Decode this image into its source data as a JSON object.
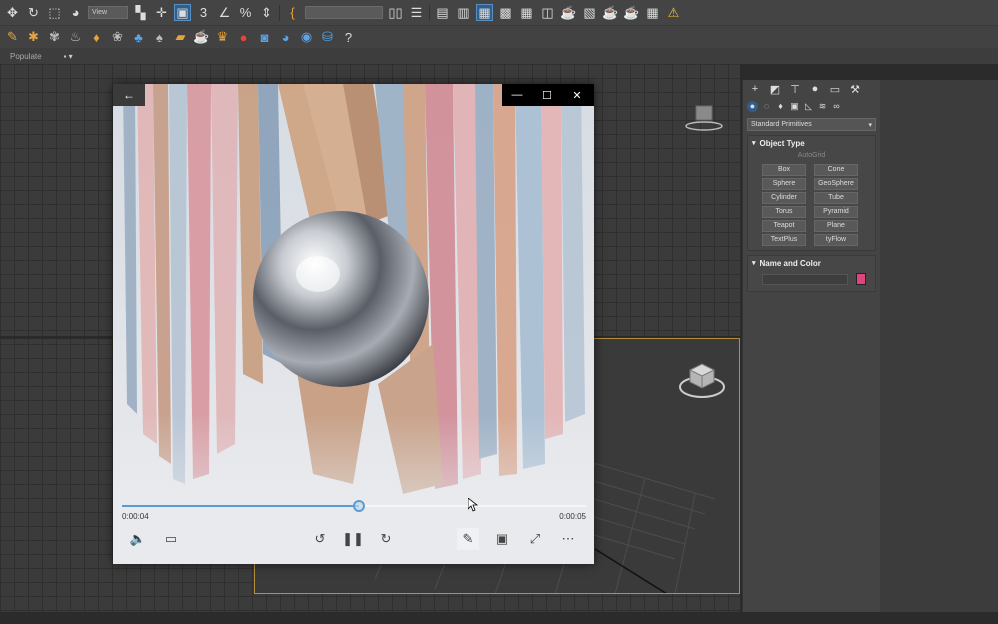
{
  "toolbar_main": {
    "view_dropdown": "View"
  },
  "toolbar_populate": {
    "populate_label": "Populate",
    "populate_dropdown": "▪ ▾"
  },
  "command_panel": {
    "primitive_category": "Standard Primitives",
    "object_type": {
      "title": "Object Type",
      "autogrid": "AutoGrid",
      "buttons": [
        "Box",
        "Cone",
        "Sphere",
        "GeoSphere",
        "Cylinder",
        "Tube",
        "Torus",
        "Pyramid",
        "Teapot",
        "Plane",
        "TextPlus",
        "tyFlow"
      ]
    },
    "name_and_color": {
      "title": "Name and Color",
      "swatch_color": "#e0447e"
    }
  },
  "player": {
    "current_time": "0:00:04",
    "total_time": "0:00:05",
    "progress": 0.51,
    "accent_color": "#5b9bd5",
    "controls": {
      "volume": "volume-icon",
      "captions": "captions-icon",
      "skip_back": "skip-back-10-icon",
      "play_pause": "pause-icon",
      "skip_forward": "skip-forward-30-icon",
      "edit": "pencil-icon",
      "mini_view": "mini-view-icon",
      "fullscreen": "fullscreen-icon",
      "more": "more-icon"
    }
  }
}
